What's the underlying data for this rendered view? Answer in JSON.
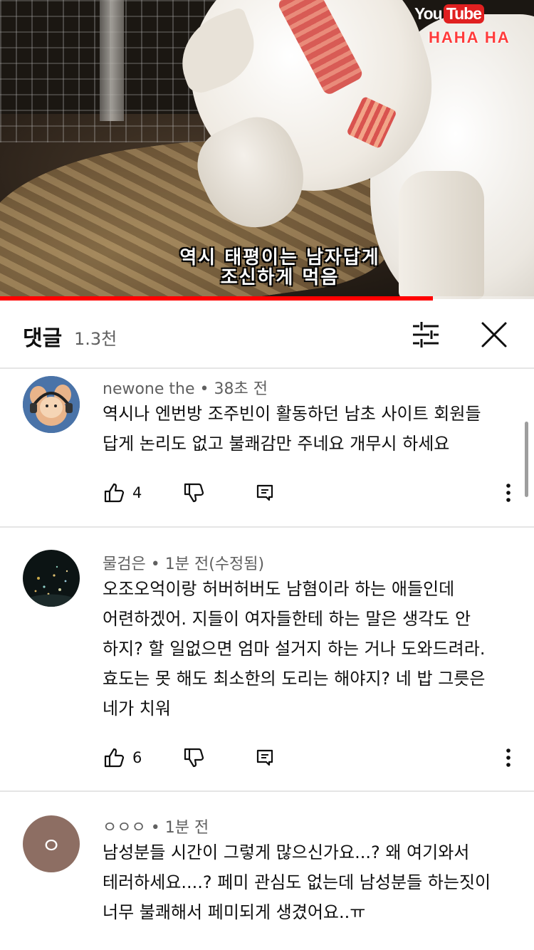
{
  "video": {
    "overlay_logo_you": "You",
    "overlay_logo_tube": "Tube",
    "overlay_channel": "HAHA HA",
    "subtitle_line1": "역시 태평이는 남자답게",
    "subtitle_line2": "조신하게 먹음",
    "progress_fraction": 0.81
  },
  "comments_header": {
    "title": "댓글",
    "count": "1.3천",
    "sort_icon": "sort-filter-icon",
    "close_icon": "close-icon"
  },
  "comments": [
    {
      "author": "newone the",
      "time": "38초 전",
      "text": "역시나 엔번방 조주빈이 활동하던 남초 사이트 회원들 답게 논리도 없고 불쾌감만 주네요 개무시 하세요",
      "likes": "4",
      "avatar_icon": "cartoon-mouse-avatar"
    },
    {
      "author": "물검은",
      "time": "1분 전(수정됨)",
      "text": "오조오억이랑 허버허버도 남혐이라 하는 애들인데 어련하겠어. 지들이 여자들한테 하는 말은 생각도 안 하지? 할 일없으면 엄마 설거지 하는 거나 도와드려라. 효도는 못 해도 최소한의 도리는 해야지? 네 밥 그릇은 네가 치워",
      "likes": "6",
      "avatar_icon": "night-city-avatar"
    },
    {
      "author": "ㅇㅇㅇ",
      "time": "1분 전",
      "text": "남성분들 시간이 그렇게 많으신가요...? 왜 여기와서 테러하세요....? 페미 관심도 없는데 남성분들 하는짓이 너무 불쾌해서 페미되게 생겼어요..ㅠ",
      "avatar_letter": "ㅇ",
      "avatar_color": "#8d6e63"
    }
  ],
  "colors": {
    "progress_red": "#ff0000",
    "meta_gray": "#606060",
    "divider": "#e5e5e5"
  }
}
